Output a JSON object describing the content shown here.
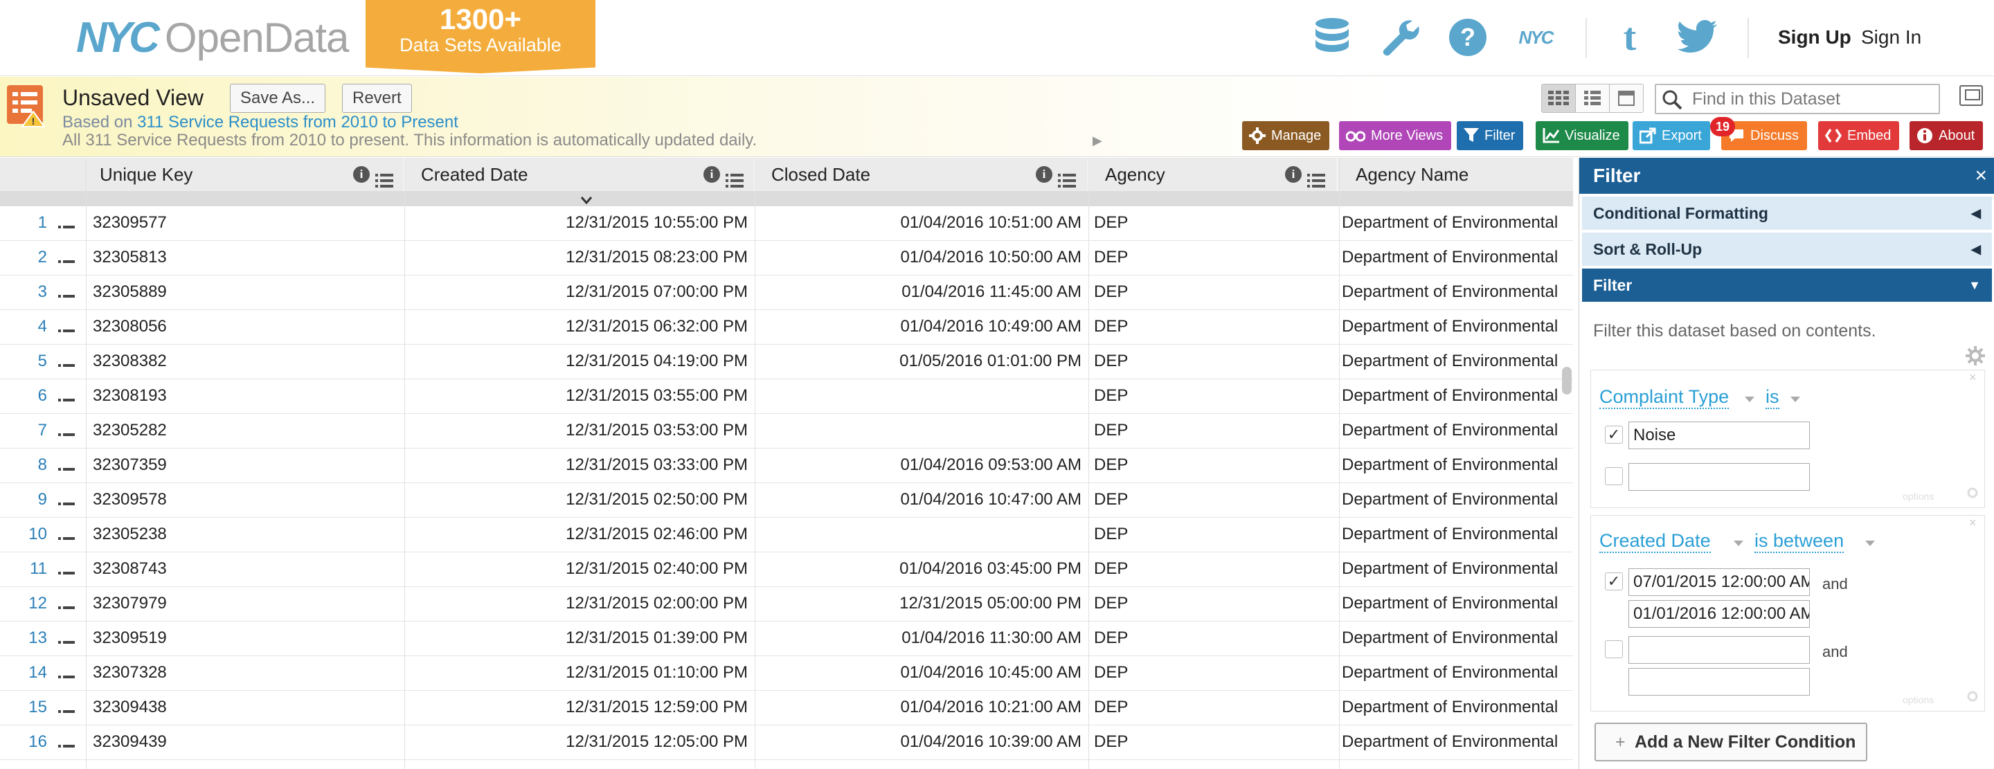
{
  "header": {
    "logo_nyc": "NYC",
    "logo_opendata": "OpenData",
    "ribbon_big": "1300+",
    "ribbon_small": "Data Sets Available",
    "icons": [
      "database-icon",
      "wrench-icon",
      "help-icon",
      "nyc-icon",
      "tumblr-icon",
      "twitter-icon"
    ],
    "nyc_icon_text": "NYC",
    "tumblr_icon_text": "t",
    "signup": "Sign Up",
    "signin": "Sign In",
    "brand_color": "#5aa6cc",
    "ribbon_color": "#f4ad3c"
  },
  "view": {
    "title": "Unsaved View",
    "save_as": "Save As...",
    "revert": "Revert",
    "based_on_prefix": "Based on ",
    "based_on_link": "311 Service Requests from 2010 to Present",
    "note": "All 311 Service Requests from 2010 to present. This information is automatically updated daily.",
    "find_placeholder": "Find in this Dataset",
    "badge_count": "19",
    "toolbar": [
      {
        "label": "Manage",
        "color": "#8a5a22"
      },
      {
        "label": "More Views",
        "color": "#b046b8"
      },
      {
        "label": "Filter",
        "color": "#1f6fae"
      },
      {
        "label": "Visualize",
        "color": "#1e8a4a"
      },
      {
        "label": "Export",
        "color": "#3aa6d8"
      },
      {
        "label": "Discuss",
        "color": "#f57b2a"
      },
      {
        "label": "Embed",
        "color": "#e23a3a"
      },
      {
        "label": "About",
        "color": "#b8252a"
      }
    ]
  },
  "grid": {
    "columns": [
      "Unique Key",
      "Created Date",
      "Closed Date",
      "Agency",
      "Agency Name"
    ],
    "rows": [
      {
        "n": "1",
        "key": "32309577",
        "created": "12/31/2015 10:55:00 PM",
        "closed": "01/04/2016 10:51:00 AM",
        "agency": "DEP",
        "agency_name": "Department of Environmental Protection"
      },
      {
        "n": "2",
        "key": "32305813",
        "created": "12/31/2015 08:23:00 PM",
        "closed": "01/04/2016 10:50:00 AM",
        "agency": "DEP",
        "agency_name": "Department of Environmental Protection"
      },
      {
        "n": "3",
        "key": "32305889",
        "created": "12/31/2015 07:00:00 PM",
        "closed": "01/04/2016 11:45:00 AM",
        "agency": "DEP",
        "agency_name": "Department of Environmental Protection"
      },
      {
        "n": "4",
        "key": "32308056",
        "created": "12/31/2015 06:32:00 PM",
        "closed": "01/04/2016 10:49:00 AM",
        "agency": "DEP",
        "agency_name": "Department of Environmental Protection"
      },
      {
        "n": "5",
        "key": "32308382",
        "created": "12/31/2015 04:19:00 PM",
        "closed": "01/05/2016 01:01:00 PM",
        "agency": "DEP",
        "agency_name": "Department of Environmental Protection"
      },
      {
        "n": "6",
        "key": "32308193",
        "created": "12/31/2015 03:55:00 PM",
        "closed": "",
        "agency": "DEP",
        "agency_name": "Department of Environmental Protection"
      },
      {
        "n": "7",
        "key": "32305282",
        "created": "12/31/2015 03:53:00 PM",
        "closed": "",
        "agency": "DEP",
        "agency_name": "Department of Environmental Protection"
      },
      {
        "n": "8",
        "key": "32307359",
        "created": "12/31/2015 03:33:00 PM",
        "closed": "01/04/2016 09:53:00 AM",
        "agency": "DEP",
        "agency_name": "Department of Environmental Protection"
      },
      {
        "n": "9",
        "key": "32309578",
        "created": "12/31/2015 02:50:00 PM",
        "closed": "01/04/2016 10:47:00 AM",
        "agency": "DEP",
        "agency_name": "Department of Environmental Protection"
      },
      {
        "n": "10",
        "key": "32305238",
        "created": "12/31/2015 02:46:00 PM",
        "closed": "",
        "agency": "DEP",
        "agency_name": "Department of Environmental Protection"
      },
      {
        "n": "11",
        "key": "32308743",
        "created": "12/31/2015 02:40:00 PM",
        "closed": "01/04/2016 03:45:00 PM",
        "agency": "DEP",
        "agency_name": "Department of Environmental Protection"
      },
      {
        "n": "12",
        "key": "32307979",
        "created": "12/31/2015 02:00:00 PM",
        "closed": "12/31/2015 05:00:00 PM",
        "agency": "DEP",
        "agency_name": "Department of Environmental Protection"
      },
      {
        "n": "13",
        "key": "32309519",
        "created": "12/31/2015 01:39:00 PM",
        "closed": "01/04/2016 11:30:00 AM",
        "agency": "DEP",
        "agency_name": "Department of Environmental Protection"
      },
      {
        "n": "14",
        "key": "32307328",
        "created": "12/31/2015 01:10:00 PM",
        "closed": "01/04/2016 10:45:00 AM",
        "agency": "DEP",
        "agency_name": "Department of Environmental Protection"
      },
      {
        "n": "15",
        "key": "32309438",
        "created": "12/31/2015 12:59:00 PM",
        "closed": "01/04/2016 10:21:00 AM",
        "agency": "DEP",
        "agency_name": "Department of Environmental Protection"
      },
      {
        "n": "16",
        "key": "32309439",
        "created": "12/31/2015 12:05:00 PM",
        "closed": "01/04/2016 10:39:00 AM",
        "agency": "DEP",
        "agency_name": "Department of Environmental Protection"
      }
    ]
  },
  "sidebar": {
    "title": "Filter",
    "close": "×",
    "sections": [
      "Conditional Formatting",
      "Sort & Roll-Up",
      "Filter"
    ],
    "description": "Filter this dataset based on contents.",
    "filter1": {
      "column": "Complaint Type",
      "operator": "is",
      "value1": "Noise",
      "value1_checked": true,
      "value2": "",
      "value2_checked": false
    },
    "filter2": {
      "column": "Created Date",
      "operator": "is between",
      "from1": "07/01/2015 12:00:00 AM",
      "to1": "01/01/2016 12:00:00 AM",
      "from2": "",
      "to2": "",
      "and_label": "and",
      "row1_checked": true,
      "row2_checked": false
    },
    "options_label": "options",
    "add_condition": "Add a New Filter Condition",
    "add_plus": "+"
  }
}
